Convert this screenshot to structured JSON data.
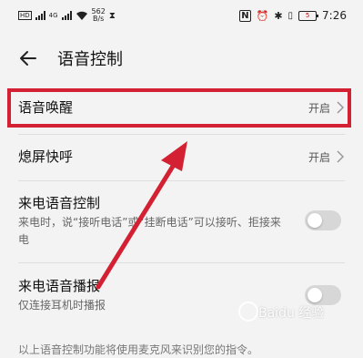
{
  "status_bar": {
    "sim1": "HD",
    "sim2": "4G",
    "net_speed_value": "562",
    "net_speed_unit": "B/s",
    "battery": "5",
    "time": "7:26"
  },
  "header": {
    "title": "语音控制"
  },
  "settings": [
    {
      "label": "语音唤醒",
      "value": "开启"
    },
    {
      "label": "熄屏快呼",
      "value": "开启"
    },
    {
      "label": "来电语音控制",
      "description": "来电时，说“接听电话”或“挂断电话”可以接听、拒接来电",
      "enabled": false
    },
    {
      "label": "来电语音播报",
      "description": "仅连接耳机时播报",
      "enabled": false
    }
  ],
  "footnote": "以上语音控制功能将使用麦克风来识别您的指令。",
  "watermark": "Baidu 经验",
  "annotation": {
    "highlight_color": "#d32033"
  }
}
